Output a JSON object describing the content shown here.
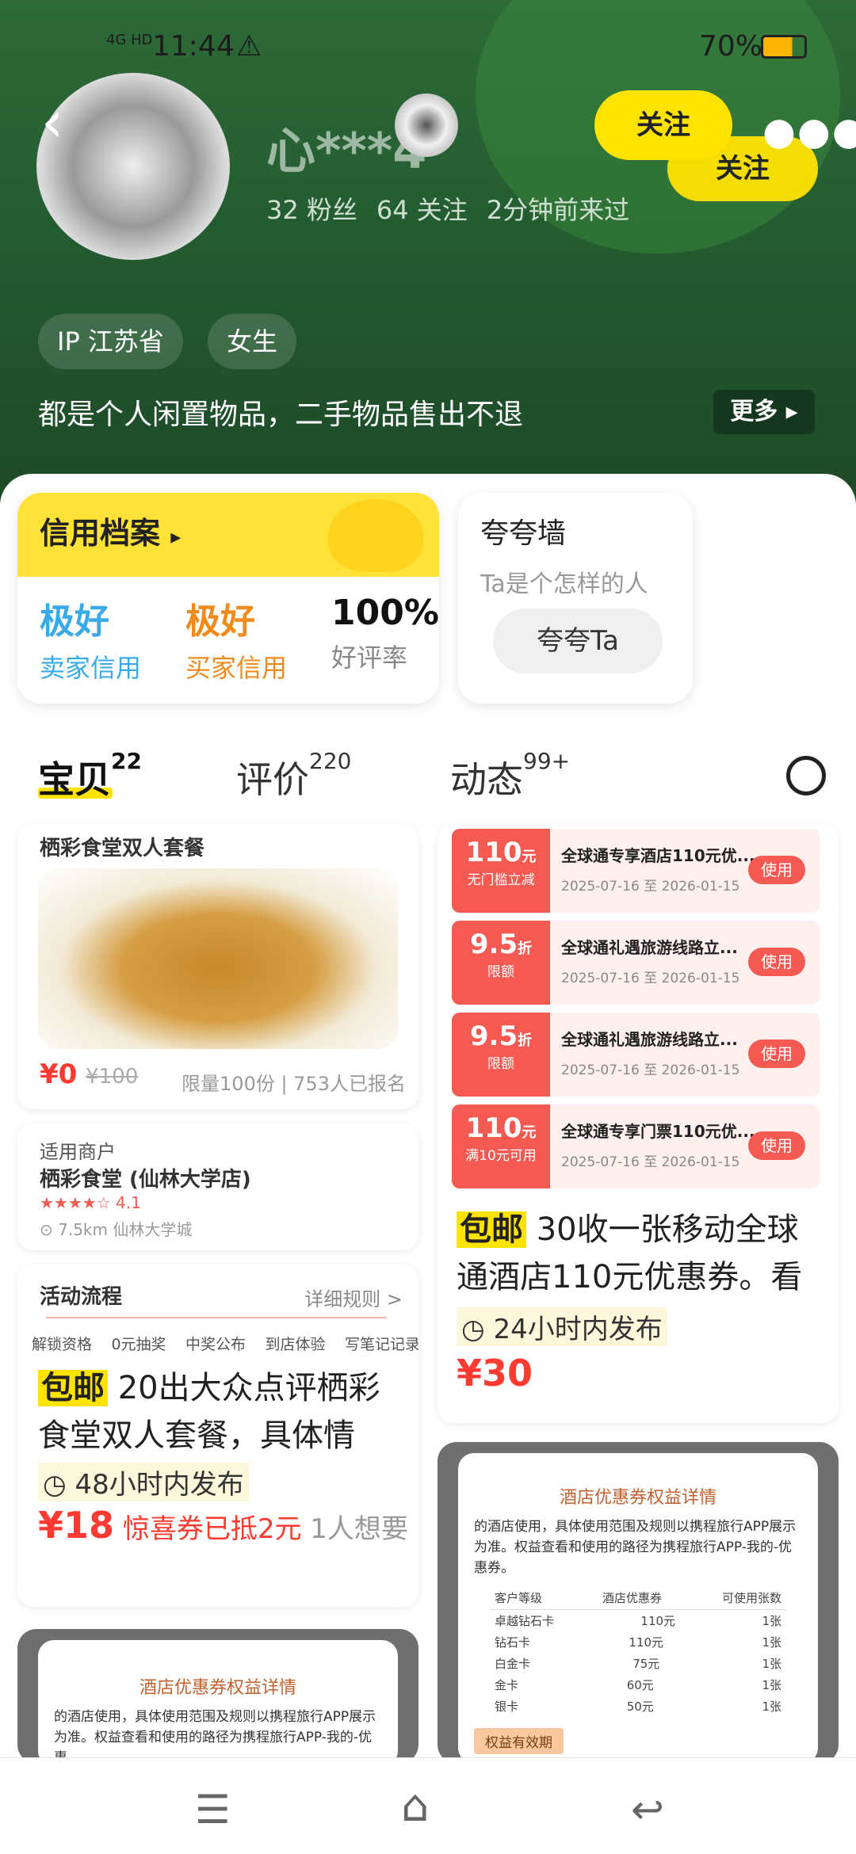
{
  "status": {
    "time": "11:44",
    "signal": "4G HD",
    "battery": "70%"
  },
  "profile": {
    "name": "心***4",
    "followers": "32 粉丝",
    "following": "64 关注",
    "last_seen": "2分钟前来过",
    "follow_label": "关注",
    "follow_label_2": "关注",
    "tags": [
      "IP 江苏省",
      "女生"
    ],
    "bio": "都是个人闲置物品，二手物品售出不退",
    "more_label": "更多"
  },
  "credit": {
    "title": "信用档案",
    "seller_val": "极好",
    "seller_lab": "卖家信用",
    "buyer_val": "极好",
    "buyer_lab": "买家信用",
    "rate_val": "100%",
    "rate_lab": "好评率",
    "colors": {
      "seller": "#39a9e8",
      "buyer": "#f08a1c"
    }
  },
  "praise": {
    "title": "夸夸墙",
    "subtitle": "Ta是个怎样的人",
    "button": "夸夸Ta"
  },
  "tabs": [
    {
      "label": "宝贝",
      "count": "22"
    },
    {
      "label": "评价",
      "count": "220"
    },
    {
      "label": "动态",
      "count": "99+"
    }
  ],
  "item1": {
    "meal_title": "栖彩食堂双人套餐",
    "price_now": "¥0",
    "price_old": "¥100",
    "limit": "限量100份 | 753人已报名",
    "merchant_head": "适用商户",
    "merchant": "栖彩食堂 (仙林大学店)",
    "rating": "4.1",
    "distance": "7.5km  仙林大学城",
    "flow_head": "活动流程",
    "flow_rule": "详细规则 >",
    "steps": [
      "解锁资格",
      "0元抽奖",
      "中奖公布",
      "到店体验",
      "写笔记记录"
    ],
    "baoyou": "包邮",
    "title": " 20出大众点评栖彩食堂双人套餐，具体情",
    "time": "48小时内发布",
    "price": "¥18",
    "coupon": "惊喜券已抵2元",
    "wants": "1人想要"
  },
  "item2": {
    "coupons": [
      {
        "amount": "110",
        "unit": "元",
        "cond": "无门槛立减",
        "name": "全球通专享酒店110元优...",
        "date": "2025-07-16 至 2026-01-15",
        "use": "使用"
      },
      {
        "amount": "9.5",
        "unit": "折",
        "cond": "限额",
        "name": "全球通礼遇旅游线路立...",
        "date": "2025-07-16 至 2026-01-15",
        "use": "使用"
      },
      {
        "amount": "9.5",
        "unit": "折",
        "cond": "限额",
        "name": "全球通礼遇旅游线路立...",
        "date": "2025-07-16 至 2026-01-15",
        "use": "使用"
      },
      {
        "amount": "110",
        "unit": "元",
        "cond": "满10元可用",
        "name": "全球通专享门票110元优...",
        "date": "2025-07-16 至 2026-01-15",
        "use": "使用"
      }
    ],
    "baoyou": "包邮",
    "title": " 30收一张移动全球通酒店110元优惠券。看",
    "time": "24小时内发布",
    "price": "¥30"
  },
  "detail": {
    "heading": "酒店优惠券权益详情",
    "text": "的酒店使用，具体使用范围及规则以携程旅行APP展示为准。权益查看和使用的路径为携程旅行APP-我的-优惠券。",
    "text_short": "的酒店使用，具体使用范围及规则以携程旅行APP展示为准。权益查看和使用的路径为携程旅行APP-我的-优惠",
    "table_head": [
      "客户等级",
      "酒店优惠券",
      "可使用张数"
    ],
    "rows": [
      [
        "卓越钻石卡",
        "110元",
        "1张"
      ],
      [
        "钻石卡",
        "110元",
        "1张"
      ],
      [
        "白金卡",
        "75元",
        "1张"
      ],
      [
        "金卡",
        "60元",
        "1张"
      ],
      [
        "银卡",
        "50元",
        "1张"
      ]
    ],
    "footer": "权益有效期"
  }
}
